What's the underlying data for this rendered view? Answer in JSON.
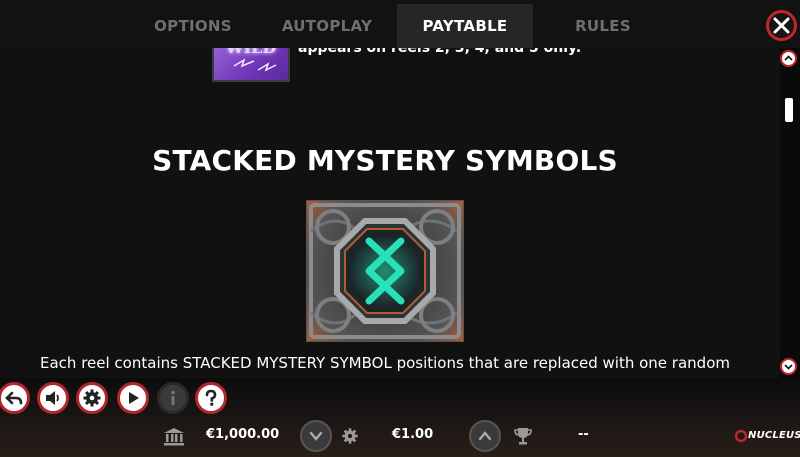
{
  "tabs": {
    "options": "OPTIONS",
    "autoplay": "AUTOPLAY",
    "paytable": "PAYTABLE",
    "rules": "RULES",
    "active": "PAYTABLE"
  },
  "content": {
    "wild_symbol_label": "WILD",
    "wild_text": "appears on reels 2, 3, 4, and 5 only.",
    "section_title": "STACKED MYSTERY SYMBOLS",
    "description": "Each reel contains STACKED MYSTERY SYMBOL positions that are replaced with one random"
  },
  "scroll": {
    "position_fraction": 0.1
  },
  "footer": {
    "balance": "€1,000.00",
    "bet": "€1.00",
    "win": "--",
    "brand": "NUCLEUS"
  },
  "icons": {
    "close": "close-icon",
    "back": "back-arrow-icon",
    "sound": "speaker-icon",
    "settings": "gear-icon",
    "play": "play-icon",
    "info": "info-icon",
    "help": "question-icon",
    "balance": "bank-icon",
    "bet": "gear-icon",
    "win": "trophy-icon"
  },
  "colors": {
    "accent": "#c0262c",
    "active_tab_bg": "#262626",
    "inactive_tab_text": "#6f6f6f",
    "rune_glow": "#27e2b9"
  }
}
